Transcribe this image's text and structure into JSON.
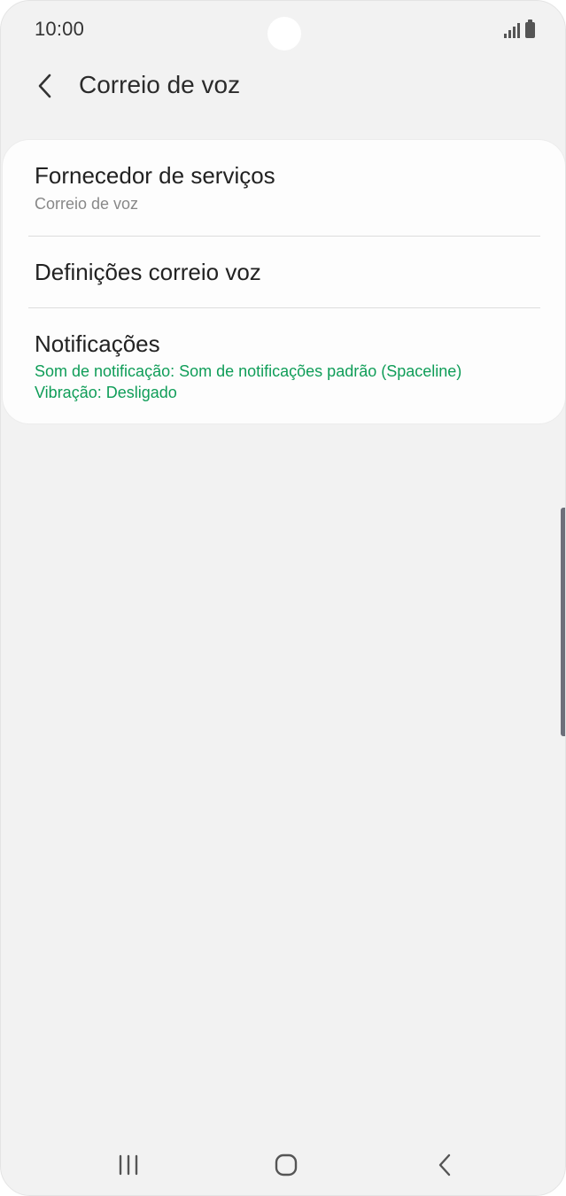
{
  "status_bar": {
    "time": "10:00"
  },
  "header": {
    "title": "Correio de voz"
  },
  "items": [
    {
      "title": "Fornecedor de serviços",
      "subtitle": "Correio de voz"
    },
    {
      "title": "Definições correio voz"
    },
    {
      "title": "Notificações",
      "subtitle_line1": "Som de notificação: Som de notificações padrão (Spaceline)",
      "subtitle_line2": "Vibração: Desligado"
    }
  ],
  "colors": {
    "background": "#f2f2f2",
    "card": "#fdfdfd",
    "accent_green": "#0f9d58",
    "text_primary": "#222222",
    "text_secondary": "#888888"
  },
  "icons": {
    "back": "chevron-left-icon",
    "recents": "recents-icon",
    "home": "home-icon",
    "nav_back": "nav-back-icon",
    "signal": "signal-icon",
    "battery": "battery-icon"
  }
}
